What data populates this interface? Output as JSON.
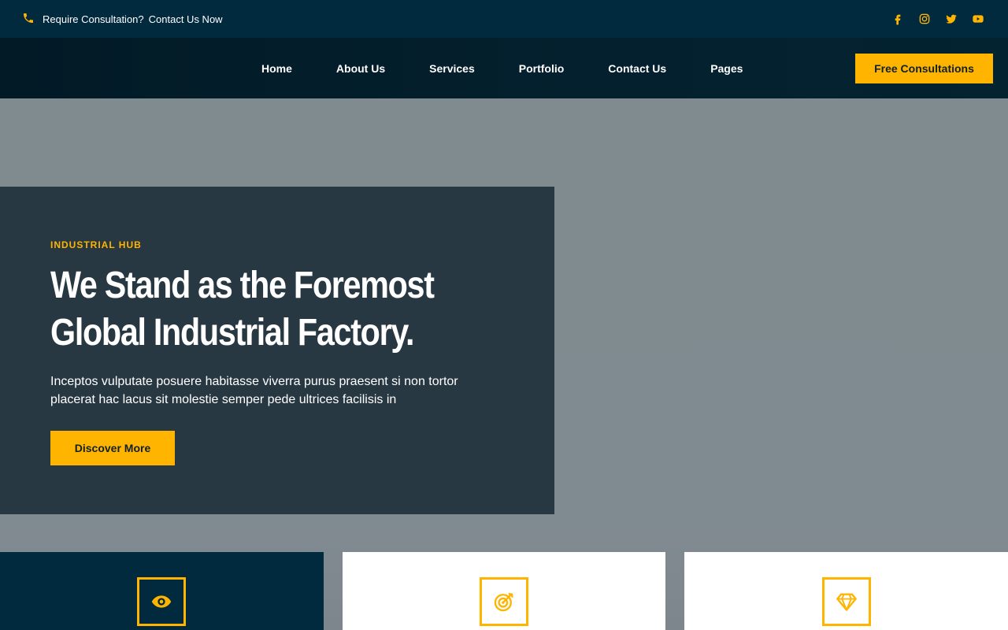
{
  "topbar": {
    "consultation_prompt": "Require Consultation?",
    "contact_link": "Contact Us Now",
    "icons": [
      "phone-icon",
      "facebook-icon",
      "instagram-icon",
      "twitter-icon",
      "youtube-icon"
    ]
  },
  "nav": {
    "items": [
      {
        "label": "Home"
      },
      {
        "label": "About Us"
      },
      {
        "label": "Services"
      },
      {
        "label": "Portfolio"
      },
      {
        "label": "Contact Us"
      },
      {
        "label": "Pages"
      }
    ],
    "cta_label": "Free Consultations"
  },
  "hero": {
    "eyebrow": "INDUSTRIAL HUB",
    "title_line1": "We Stand as the Foremost",
    "title_line2": "Global Industrial Factory.",
    "description": "Inceptos vulputate posuere habitasse viverra purus praesent si non tortor placerat hac lacus sit molestie semper pede ultrices facilisis in",
    "button_label": "Discover More"
  },
  "cards": [
    {
      "icon": "eye-icon"
    },
    {
      "icon": "target-icon"
    },
    {
      "icon": "diamond-icon"
    }
  ],
  "colors": {
    "accent": "#ffb400",
    "topbar_bg": "#022a3f",
    "nav_bg": "#021a26",
    "hero_box_bg": "#283842",
    "hero_bg": "#808b90",
    "card_dark_bg": "#022a3f",
    "card_light_bg": "#ffffff"
  }
}
